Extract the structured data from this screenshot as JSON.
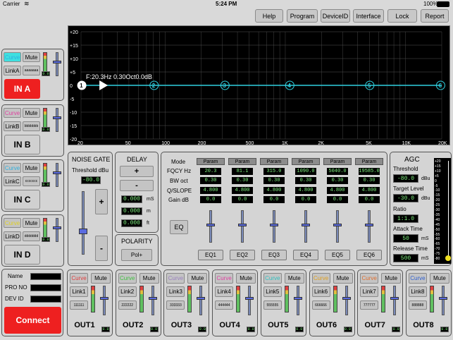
{
  "status": {
    "carrier": "Carrier",
    "time": "5:24 PM",
    "battery": "100%"
  },
  "top": [
    "Help",
    "Program",
    "DeviceID",
    "Interface",
    "Lock",
    "Report"
  ],
  "graph": {
    "readout": "F:20.3Hz 0.30Oct0.0dB",
    "ylabels": [
      "+20",
      "+15",
      "+10",
      "+5",
      "0",
      "-5",
      "-10",
      "-15",
      "-20"
    ],
    "xlabels": [
      "20",
      "50",
      "100",
      "200",
      "500",
      "1K",
      "2K",
      "5K",
      "10K",
      "20K"
    ],
    "points": [
      "1",
      "2",
      "3",
      "4",
      "5",
      "6"
    ]
  },
  "inputs": [
    {
      "curve": "Curve",
      "mute": "Mute",
      "link": "LinkA",
      "code": "aaaaaaa",
      "lvl": "0.0",
      "name": "IN A",
      "curve_color": "#2fb0e0",
      "active": true
    },
    {
      "curve": "Curve",
      "mute": "Mute",
      "link": "LinkB",
      "code": "bbbbbbb",
      "lvl": "0.0",
      "name": "IN B",
      "curve_color": "#e040a0",
      "active": false
    },
    {
      "curve": "Curve",
      "mute": "Mute",
      "link": "LinkC",
      "code": "ccccccc",
      "lvl": "0.0",
      "name": "IN C",
      "curve_color": "#2fb0e0",
      "active": false
    },
    {
      "curve": "Curve",
      "mute": "Mute",
      "link": "LinkD",
      "code": "ddddddd",
      "lvl": "0.0",
      "name": "IN D",
      "curve_color": "#e0d020",
      "active": false
    }
  ],
  "device": {
    "name_label": "Name",
    "pro_label": "PRO NO",
    "dev_label": "DEV ID",
    "connect": "Connect"
  },
  "gate": {
    "title": "NOISE GATE",
    "threshold_label": "Threshold dBu",
    "threshold": "-80.0",
    "plus": "+",
    "minus": "-"
  },
  "delay": {
    "title": "DELAY",
    "plus": "+",
    "minus": "-",
    "ms_value": "0.000",
    "ms": "mS",
    "m_value": "0.000",
    "m": "m",
    "ft_value": "0.000",
    "ft": "ft"
  },
  "polarity": {
    "title": "POLARITY",
    "button": "Pol+"
  },
  "peq": {
    "row_labels": [
      "Mode",
      "FQCY Hz",
      "BW oct",
      "Q/SLOPE",
      "Gain dB"
    ],
    "eq_button": "EQ",
    "bands": [
      {
        "mode": "Param",
        "freq": "20.3",
        "bw": "0.30",
        "q": "4.800",
        "gain": "0.0",
        "name": "EQ1"
      },
      {
        "mode": "Param",
        "freq": "81.1",
        "bw": "0.30",
        "q": "4.800",
        "gain": "0.0",
        "name": "EQ2"
      },
      {
        "mode": "Param",
        "freq": "315.0",
        "bw": "0.30",
        "q": "4.800",
        "gain": "0.0",
        "name": "EQ3"
      },
      {
        "mode": "Param",
        "freq": "1090.0",
        "bw": "0.30",
        "q": "4.800",
        "gain": "0.0",
        "name": "EQ4"
      },
      {
        "mode": "Param",
        "freq": "5040.0",
        "bw": "0.30",
        "q": "4.800",
        "gain": "0.0",
        "name": "EQ5"
      },
      {
        "mode": "Param",
        "freq": "19585.0",
        "bw": "0.30",
        "q": "4.800",
        "gain": "0.0",
        "name": "EQ6"
      }
    ]
  },
  "agc": {
    "title": "AGC",
    "threshold_label": "Threshold",
    "threshold": "-80.0",
    "threshold_unit": "dBu",
    "target_label": "Target Level",
    "target": "-30.0",
    "target_unit": "dBu",
    "ratio_label": "Ratio",
    "ratio": "1:1.0",
    "attack_label": "Attack Time",
    "attack": "50",
    "attack_unit": "mS",
    "release_label": "Release Time",
    "release": "500",
    "release_unit": "mS",
    "scale": [
      "+20",
      "+15",
      "+10",
      "+5",
      "0",
      "-5",
      "-10",
      "-15",
      "-20",
      "-25",
      "-30",
      "-35",
      "-40",
      "-45",
      "-50",
      "-55",
      "-60",
      "-65",
      "-70",
      "-75",
      "-80"
    ]
  },
  "outputs": [
    {
      "curve": "Curve",
      "mute": "Mute",
      "link": "Link1",
      "code": "111111",
      "lvl": "0.0",
      "name": "OUT1",
      "curve_color": "#e04040"
    },
    {
      "curve": "Curve",
      "mute": "Mute",
      "link": "Link2",
      "code": "222222",
      "lvl": "0.0",
      "name": "OUT2",
      "curve_color": "#40c040"
    },
    {
      "curve": "Curve",
      "mute": "Mute",
      "link": "Link3",
      "code": "333333",
      "lvl": "0.0",
      "name": "OUT3",
      "curve_color": "#9a80c0"
    },
    {
      "curve": "Curve",
      "mute": "Mute",
      "link": "Link4",
      "code": "444444",
      "lvl": "0.0",
      "name": "OUT4",
      "curve_color": "#e040a0"
    },
    {
      "curve": "Curve",
      "mute": "Mute",
      "link": "Link5",
      "code": "555555",
      "lvl": "0.0",
      "name": "OUT5",
      "curve_color": "#30c0c0"
    },
    {
      "curve": "Curve",
      "mute": "Mute",
      "link": "Link6",
      "code": "666666",
      "lvl": "0.0",
      "name": "OUT6",
      "curve_color": "#e0a020"
    },
    {
      "curve": "Curve",
      "mute": "Mute",
      "link": "Link7",
      "code": "777777",
      "lvl": "0.0",
      "name": "OUT7",
      "curve_color": "#e07030"
    },
    {
      "curve": "Curve",
      "mute": "Mute",
      "link": "Link8",
      "code": "888888",
      "lvl": "0.0",
      "name": "OUT8",
      "curve_color": "#3060d0"
    }
  ]
}
